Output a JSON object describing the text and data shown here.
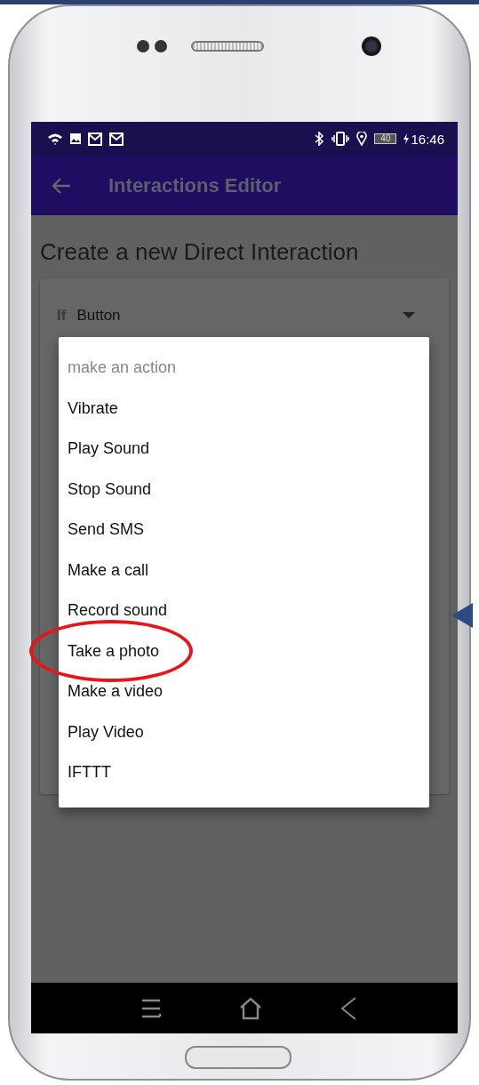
{
  "status_bar": {
    "battery": "40",
    "time": "16:46"
  },
  "app_bar": {
    "title": "Interactions Editor"
  },
  "heading": "Create a new Direct Interaction",
  "condition": {
    "label": "If",
    "value": "Button"
  },
  "menu": {
    "items": [
      {
        "label": "make an action",
        "kind": "hint",
        "circled": false
      },
      {
        "label": "Vibrate",
        "kind": "option",
        "circled": false
      },
      {
        "label": "Play Sound",
        "kind": "option",
        "circled": false
      },
      {
        "label": "Stop Sound",
        "kind": "option",
        "circled": false
      },
      {
        "label": "Send SMS",
        "kind": "option",
        "circled": false
      },
      {
        "label": "Make a call",
        "kind": "option",
        "circled": false
      },
      {
        "label": "Record sound",
        "kind": "option",
        "circled": false
      },
      {
        "label": "Take a photo",
        "kind": "option",
        "circled": true
      },
      {
        "label": "Make a video",
        "kind": "option",
        "circled": false
      },
      {
        "label": "Play Video",
        "kind": "option",
        "circled": false
      },
      {
        "label": "IFTTT",
        "kind": "option",
        "circled": false
      }
    ]
  }
}
